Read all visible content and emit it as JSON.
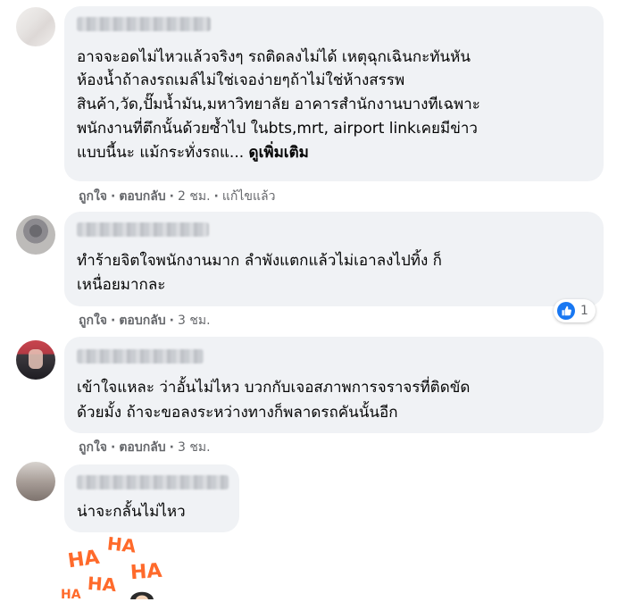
{
  "comments": [
    {
      "text_lines": [
        "อาจจะอดไม่ไหวแล้วจริงๆ รถติดลงไม่ได้ เหตุฉุกเฉินกะทันหัน",
        "ห้องน้ำถ้าลงรถเมล์ไม่ใช่เจอง่ายๆถ้าไม่ใช่ห้างสรรพ",
        "สินค้า,วัด,ปั๊มน้ำมัน,มหาวิทยาลัย อาคารสำนักงานบางทีเฉพาะ",
        "พนักงานที่ตึกนั้นด้วยซ้ำไป ในbts,mrt, airport linkเคยมีข่าว",
        "แบบนี้นะ แม้กระทั่งรถแ..."
      ],
      "see_more": "ดูเพิ่มเติม",
      "like": "ถูกใจ",
      "reply": "ตอบกลับ",
      "time": "2 ชม.",
      "edited": "แก้ไขแล้ว"
    },
    {
      "text_lines": [
        "ทำร้ายจิตใจพนักงานมาก ลำพังแตกแล้วไม่เอาลงไปทิ้ง ก็",
        "เหนื่อยมากละ"
      ],
      "like": "ถูกใจ",
      "reply": "ตอบกลับ",
      "time": "3 ชม.",
      "reaction_count": "1",
      "reaction_icon": "like-icon"
    },
    {
      "text_lines": [
        "เข้าใจแหละ ว่าอั้นไม่ไหว บวกกับเจอสภาพการจราจรที่ติดขัด",
        "ด้วยมั้ง ถ้าจะขอลงระหว่างทางก็พลาดรถคันนั้นอีก"
      ],
      "like": "ถูกใจ",
      "reply": "ตอบกลับ",
      "time": "3 ชม."
    },
    {
      "text_lines": [
        "น่าจะกลั้นไม่ไหว"
      ]
    }
  ],
  "sticker": {
    "icon": "haha-sticker",
    "words": [
      "HA",
      "HA",
      "HA",
      "HA",
      "HA"
    ]
  },
  "colors": {
    "bubble": "#f0f2f5",
    "secondary_text": "#65676b",
    "like_blue": "#1877f2",
    "sticker_orange": "#ff6a2b"
  }
}
